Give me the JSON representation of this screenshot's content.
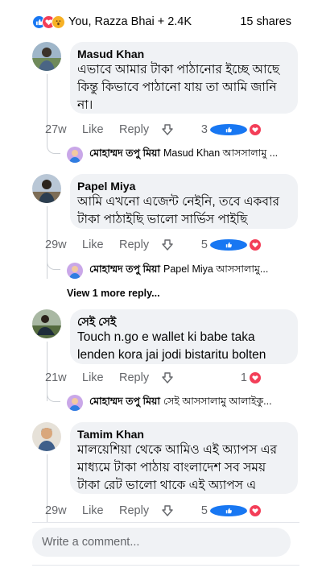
{
  "header": {
    "reactions_summary": "You, Razza Bhai + 2.4K",
    "shares": "15 shares"
  },
  "comments": [
    {
      "author": "Masud Khan",
      "text": "এভাবে আমার টাকা পাঠানোর ইচ্ছে আছে কিন্তু কিভাবে পাঠানো যায় তা আমি জানি না।",
      "time": "27w",
      "like": "Like",
      "reply": "Reply",
      "reaction_count": "3",
      "reply_preview": {
        "author": "মোহাম্মদ তপু মিয়া",
        "text": "Masud Khan আসসালামু ..."
      }
    },
    {
      "author": "Papel Miya",
      "text": "আমি এখনো এজেন্ট নেইনি, তবে একবার টাকা পাঠাইছি ভালো সার্ভিস পাইছি",
      "time": "29w",
      "like": "Like",
      "reply": "Reply",
      "reaction_count": "5",
      "reply_preview": {
        "author": "মোহাম্মদ তপু মিয়া",
        "text": "Papel Miya আসসালামু..."
      },
      "more_replies": "View 1 more reply..."
    },
    {
      "author": "সেই সেই",
      "text": "Touch n.go e wallet ki babe taka lenden kora jai jodi bistaritu bolten",
      "time": "21w",
      "like": "Like",
      "reply": "Reply",
      "reaction_count": "1",
      "reply_preview": {
        "author": "মোহাম্মদ তপু মিয়া",
        "text": "সেই আসসালামু আলাইকু..."
      }
    },
    {
      "author": "Tamim Khan",
      "text": "মালয়েশিয়া থেকে আমিও এই অ্যাপস এর মাধ্যমে টাকা পাঠায় বাংলাদেশ সব সময় টাকা রেট ভালো থাকে এই অ্যাপস এ",
      "time": "29w",
      "like": "Like",
      "reply": "Reply",
      "reaction_count": "5"
    }
  ],
  "composer": {
    "placeholder": "Write a comment..."
  },
  "colors": {
    "like": "#1877f2",
    "love": "#f33e58",
    "wow": "#f7b125",
    "bubble": "#f0f2f5",
    "meta": "#65676b"
  }
}
